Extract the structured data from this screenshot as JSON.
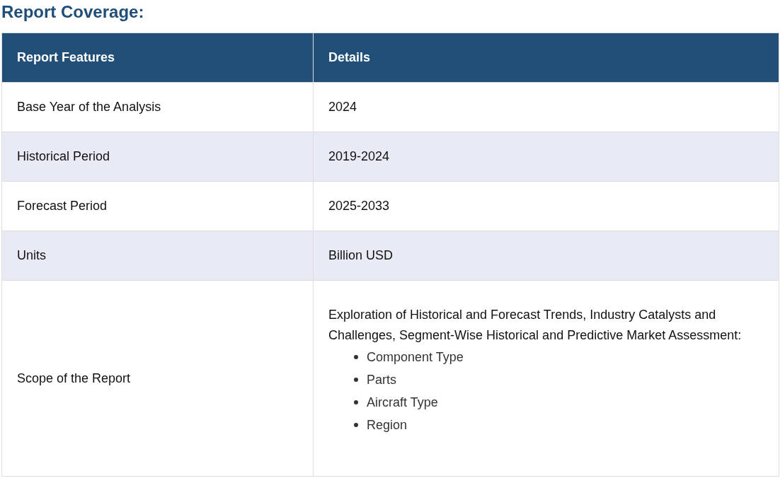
{
  "heading": "Report Coverage:",
  "table": {
    "columns": [
      "Report Features",
      "Details"
    ],
    "rows": [
      {
        "feature": "Base Year of the Analysis",
        "details": {
          "text": "2024"
        },
        "shaded": false
      },
      {
        "feature": "Historical Period",
        "details": {
          "text": "2019-2024"
        },
        "shaded": true
      },
      {
        "feature": "Forecast Period",
        "details": {
          "text": "2025-2033"
        },
        "shaded": false
      },
      {
        "feature": "Units",
        "details": {
          "text": "Billion USD"
        },
        "shaded": true
      },
      {
        "feature": "Scope of the Report",
        "details": {
          "text": "Exploration of Historical and Forecast Trends, Industry Catalysts and Challenges, Segment-Wise Historical and Predictive Market Assessment:",
          "items": [
            "Component Type",
            "Parts",
            "Aircraft Type",
            "Region"
          ]
        },
        "shaded": false
      }
    ]
  }
}
